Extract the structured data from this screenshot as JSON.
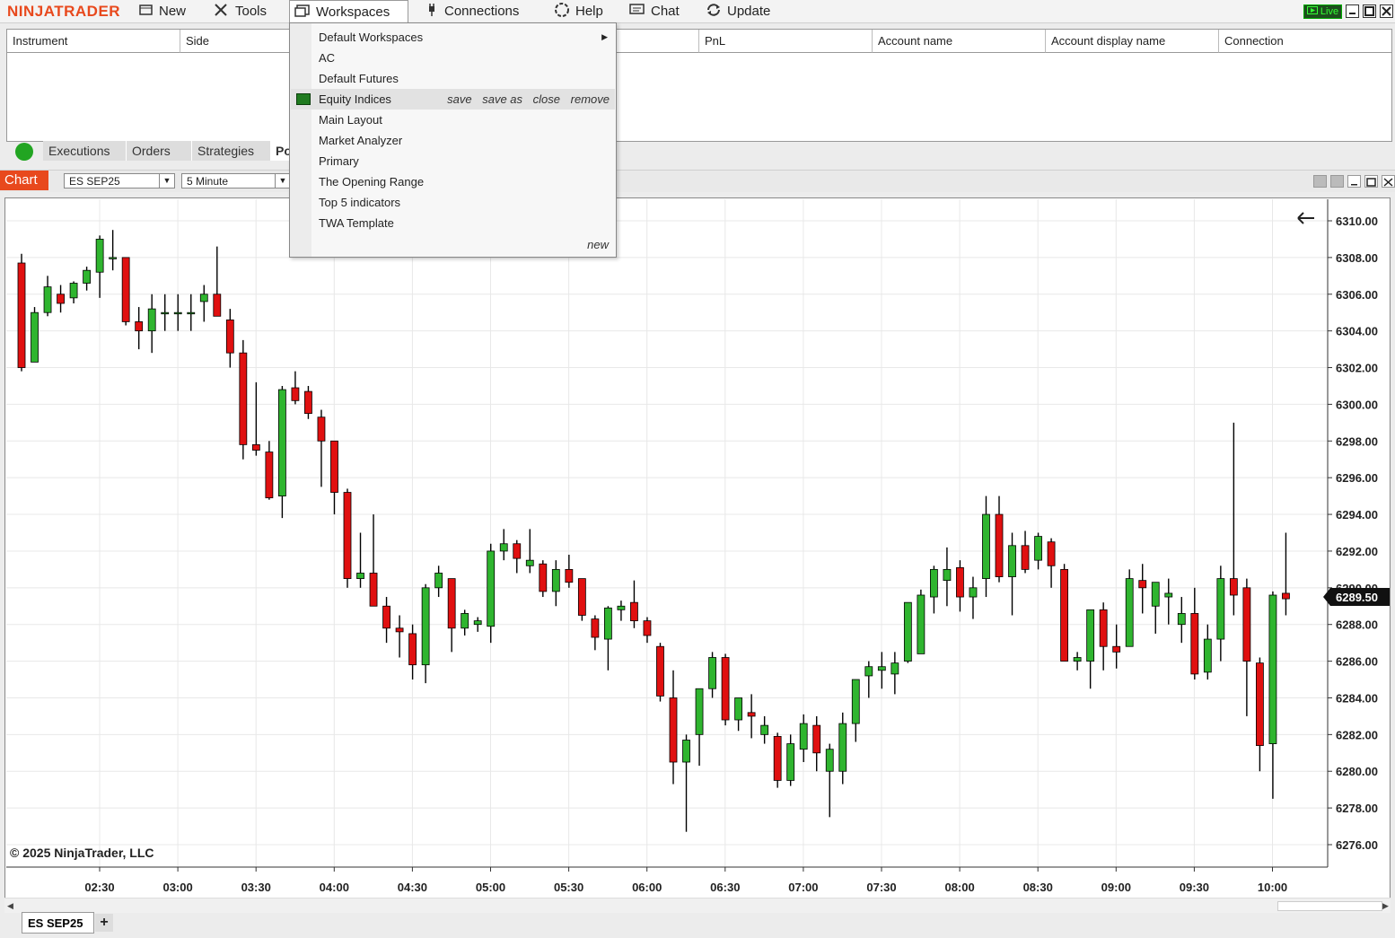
{
  "app": {
    "logo": "NINJATRADER",
    "live_badge": "Live"
  },
  "menu": [
    {
      "label": "New",
      "icon": "new-window-icon"
    },
    {
      "label": "Tools",
      "icon": "tools-icon"
    },
    {
      "label": "Workspaces",
      "icon": "workspaces-icon",
      "active": true
    },
    {
      "label": "Connections",
      "icon": "plug-icon"
    },
    {
      "label": "Help",
      "icon": "help-icon"
    },
    {
      "label": "Chat",
      "icon": "chat-icon"
    },
    {
      "label": "Update",
      "icon": "update-icon"
    }
  ],
  "positions_grid": {
    "columns": [
      "Instrument",
      "Side",
      "PnL",
      "Account name",
      "Account display name",
      "Connection"
    ]
  },
  "bottom_panel_tabs": [
    "Executions",
    "Orders",
    "Strategies",
    "Po"
  ],
  "workspaces_dropdown": {
    "items": [
      "Default Workspaces",
      "AC",
      "Default Futures",
      "Equity Indices",
      "Main Layout",
      "Market Analyzer",
      "Primary",
      "The Opening Range",
      "Top 5 indicators",
      "TWA Template"
    ],
    "selected": "Equity Indices",
    "actions": [
      "save",
      "save as",
      "close",
      "remove"
    ],
    "new_label": "new"
  },
  "chart": {
    "title": "Chart",
    "instrument": "ES SEP25",
    "interval": "5 Minute",
    "copyright": "© 2025 NinjaTrader, LLC",
    "last_price_label": "6289.50",
    "tab_label": "ES SEP25",
    "add_tab_label": "+",
    "colors": {
      "up": "#2fb52f",
      "down": "#e01010",
      "grid": "#e8e8e8",
      "last_price_bg": "#111111"
    }
  },
  "chart_data": {
    "type": "candlestick",
    "x_tick_labels": [
      "02:30",
      "03:00",
      "03:30",
      "04:00",
      "04:30",
      "05:00",
      "05:30",
      "06:00",
      "06:30",
      "07:00",
      "07:30",
      "08:00",
      "08:30",
      "09:00",
      "09:30",
      "10:00"
    ],
    "y_tick_labels": [
      "6310.00",
      "6308.00",
      "6306.00",
      "6304.00",
      "6302.00",
      "6300.00",
      "6298.00",
      "6296.00",
      "6294.00",
      "6292.00",
      "6290.00",
      "6288.00",
      "6286.00",
      "6284.00",
      "6282.00",
      "6280.00",
      "6278.00",
      "6276.00"
    ],
    "ylim": [
      6276,
      6310
    ],
    "last_price": 6289.5,
    "candles": [
      [
        6307.7,
        6308.2,
        6301.8,
        6302.0
      ],
      [
        6302.3,
        6305.3,
        6302.3,
        6305.0
      ],
      [
        6305.0,
        6307.0,
        6304.8,
        6306.4
      ],
      [
        6306.0,
        6306.5,
        6305.0,
        6305.5
      ],
      [
        6305.8,
        6306.7,
        6305.5,
        6306.6
      ],
      [
        6306.6,
        6307.5,
        6306.2,
        6307.3
      ],
      [
        6307.2,
        6309.2,
        6305.8,
        6309.0
      ],
      [
        6308.0,
        6309.5,
        6307.3,
        6308.0
      ],
      [
        6308.0,
        6308.0,
        6304.3,
        6304.5
      ],
      [
        6304.5,
        6305.3,
        6303.0,
        6304.0
      ],
      [
        6304.0,
        6306.0,
        6302.8,
        6305.2
      ],
      [
        6305.0,
        6306.0,
        6304.0,
        6305.0
      ],
      [
        6305.0,
        6306.0,
        6304.0,
        6305.0
      ],
      [
        6305.0,
        6306.0,
        6304.0,
        6305.0
      ],
      [
        6305.6,
        6306.5,
        6304.5,
        6306.0
      ],
      [
        6306.0,
        6308.6,
        6304.8,
        6304.8
      ],
      [
        6304.6,
        6305.2,
        6302.0,
        6302.8
      ],
      [
        6302.8,
        6303.5,
        6297.0,
        6297.8
      ],
      [
        6297.8,
        6301.2,
        6297.2,
        6297.5
      ],
      [
        6297.4,
        6298.0,
        6294.8,
        6294.9
      ],
      [
        6295.0,
        6301.0,
        6293.8,
        6300.8
      ],
      [
        6300.9,
        6301.8,
        6300.0,
        6300.2
      ],
      [
        6300.7,
        6301.0,
        6299.2,
        6299.5
      ],
      [
        6299.3,
        6299.7,
        6295.5,
        6298.0
      ],
      [
        6298.0,
        6298.0,
        6294.0,
        6295.2
      ],
      [
        6295.2,
        6295.4,
        6290.0,
        6290.5
      ],
      [
        6290.5,
        6293.0,
        6290.0,
        6290.8
      ],
      [
        6290.8,
        6294.0,
        6289.0,
        6289.0
      ],
      [
        6289.0,
        6289.5,
        6287.0,
        6287.8
      ],
      [
        6287.8,
        6288.5,
        6286.2,
        6287.6
      ],
      [
        6287.5,
        6288.0,
        6285.0,
        6285.8
      ],
      [
        6285.8,
        6290.2,
        6284.8,
        6290.0
      ],
      [
        6290.0,
        6291.2,
        6289.5,
        6290.8
      ],
      [
        6290.5,
        6290.5,
        6286.5,
        6287.8
      ],
      [
        6287.8,
        6288.8,
        6287.4,
        6288.6
      ],
      [
        6288.0,
        6288.4,
        6287.6,
        6288.2
      ],
      [
        6287.9,
        6292.4,
        6287.0,
        6292.0
      ],
      [
        6292.0,
        6293.2,
        6291.5,
        6292.4
      ],
      [
        6292.4,
        6292.6,
        6290.8,
        6291.6
      ],
      [
        6291.2,
        6293.2,
        6290.8,
        6291.5
      ],
      [
        6291.3,
        6291.5,
        6289.5,
        6289.8
      ],
      [
        6289.8,
        6291.5,
        6289.0,
        6291.0
      ],
      [
        6291.0,
        6291.8,
        6290.0,
        6290.3
      ],
      [
        6290.5,
        6290.5,
        6288.2,
        6288.5
      ],
      [
        6288.3,
        6288.5,
        6286.6,
        6287.3
      ],
      [
        6287.2,
        6289.0,
        6285.5,
        6288.9
      ],
      [
        6288.8,
        6289.3,
        6288.2,
        6289.0
      ],
      [
        6289.2,
        6290.4,
        6287.8,
        6288.2
      ],
      [
        6288.2,
        6288.4,
        6287.0,
        6287.4
      ],
      [
        6286.8,
        6287.0,
        6283.8,
        6284.1
      ],
      [
        6284.0,
        6285.5,
        6279.3,
        6280.5
      ],
      [
        6280.5,
        6282.0,
        6276.7,
        6281.7
      ],
      [
        6282.0,
        6284.5,
        6280.3,
        6284.5
      ],
      [
        6284.5,
        6286.5,
        6284.0,
        6286.2
      ],
      [
        6286.2,
        6286.4,
        6282.5,
        6282.8
      ],
      [
        6282.8,
        6284.0,
        6282.2,
        6284.0
      ],
      [
        6283.2,
        6284.2,
        6281.8,
        6283.0
      ],
      [
        6282.0,
        6283.0,
        6281.5,
        6282.5
      ],
      [
        6281.9,
        6282.1,
        6279.1,
        6279.5
      ],
      [
        6279.5,
        6282.0,
        6279.2,
        6281.5
      ],
      [
        6281.2,
        6283.1,
        6280.5,
        6282.6
      ],
      [
        6282.5,
        6283.0,
        6280.0,
        6281.0
      ],
      [
        6280.0,
        6281.5,
        6277.5,
        6281.2
      ],
      [
        6280.0,
        6283.2,
        6279.3,
        6282.6
      ],
      [
        6282.6,
        6285.0,
        6281.6,
        6285.0
      ],
      [
        6285.2,
        6286.0,
        6284.0,
        6285.7
      ],
      [
        6285.5,
        6286.5,
        6284.5,
        6285.7
      ],
      [
        6285.3,
        6286.5,
        6284.2,
        6285.9
      ],
      [
        6286.0,
        6288.0,
        6285.9,
        6289.2
      ],
      [
        6286.4,
        6289.9,
        6286.4,
        6289.6
      ],
      [
        6289.5,
        6291.2,
        6288.6,
        6291.0
      ],
      [
        6290.4,
        6292.2,
        6289.0,
        6291.0
      ],
      [
        6291.1,
        6291.5,
        6288.7,
        6289.5
      ],
      [
        6289.5,
        6290.6,
        6288.3,
        6290.0
      ],
      [
        6290.5,
        6295.0,
        6289.5,
        6294.0
      ],
      [
        6294.0,
        6295.0,
        6290.3,
        6290.6
      ],
      [
        6290.6,
        6293.0,
        6288.5,
        6292.3
      ],
      [
        6292.3,
        6293.1,
        6290.8,
        6291.0
      ],
      [
        6291.5,
        6293.0,
        6291.0,
        6292.8
      ],
      [
        6292.5,
        6292.7,
        6290.0,
        6291.2
      ],
      [
        6291.0,
        6291.3,
        6286.0,
        6286.0
      ],
      [
        6286.0,
        6286.5,
        6285.5,
        6286.2
      ],
      [
        6286.0,
        6288.5,
        6284.5,
        6288.8
      ],
      [
        6288.8,
        6289.2,
        6285.5,
        6286.8
      ],
      [
        6286.8,
        6288.0,
        6285.6,
        6286.5
      ],
      [
        6286.8,
        6291.0,
        6286.8,
        6290.5
      ],
      [
        6290.4,
        6291.3,
        6288.6,
        6290.0
      ],
      [
        6289.0,
        6290.0,
        6287.5,
        6290.3
      ],
      [
        6289.5,
        6290.5,
        6288.0,
        6289.7
      ],
      [
        6288.0,
        6289.5,
        6287.0,
        6288.6
      ],
      [
        6288.6,
        6290.0,
        6285.0,
        6285.3
      ],
      [
        6285.4,
        6288.0,
        6285.0,
        6287.2
      ],
      [
        6287.2,
        6291.2,
        6286.0,
        6290.5
      ],
      [
        6290.5,
        6299.0,
        6288.5,
        6289.6
      ],
      [
        6290.0,
        6290.5,
        6283.0,
        6286.0
      ],
      [
        6285.9,
        6286.2,
        6280.0,
        6281.4
      ],
      [
        6281.5,
        6289.8,
        6278.5,
        6289.6
      ],
      [
        6289.7,
        6293.0,
        6288.5,
        6289.4
      ]
    ]
  }
}
